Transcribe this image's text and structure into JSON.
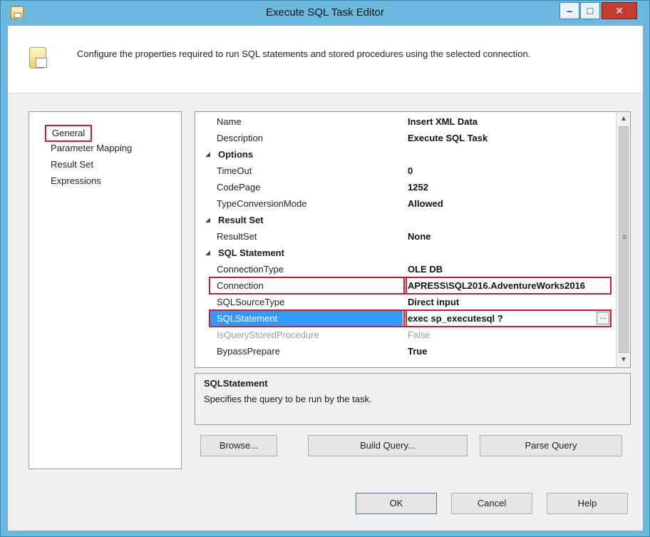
{
  "window": {
    "title": "Execute SQL Task Editor",
    "controls": {
      "minimize": "–",
      "maximize": "□",
      "close": "✕"
    }
  },
  "banner": {
    "icon": "task-editor-icon",
    "text": "Configure the properties required to run SQL statements and stored procedures using the selected connection."
  },
  "nav": {
    "items": [
      {
        "label": "General",
        "selected": true
      },
      {
        "label": "Parameter Mapping"
      },
      {
        "label": "Result Set"
      },
      {
        "label": "Expressions"
      }
    ]
  },
  "grid": {
    "rows": [
      {
        "kind": "prop",
        "name": "Name",
        "value": "Insert XML Data"
      },
      {
        "kind": "prop",
        "name": "Description",
        "value": "Execute SQL Task"
      },
      {
        "kind": "cat",
        "label": "Options",
        "toggle": "◢"
      },
      {
        "kind": "prop",
        "name": "TimeOut",
        "value": "0"
      },
      {
        "kind": "prop",
        "name": "CodePage",
        "value": "1252"
      },
      {
        "kind": "prop",
        "name": "TypeConversionMode",
        "value": "Allowed"
      },
      {
        "kind": "cat",
        "label": "Result Set",
        "toggle": "◢"
      },
      {
        "kind": "prop",
        "name": "ResultSet",
        "value": "None"
      },
      {
        "kind": "cat",
        "label": "SQL Statement",
        "toggle": "◢"
      },
      {
        "kind": "prop",
        "name": "ConnectionType",
        "value": "OLE DB"
      },
      {
        "kind": "prop",
        "name": "Connection",
        "value": "APRESS\\SQL2016.AdventureWorks2016"
      },
      {
        "kind": "prop",
        "name": "SQLSourceType",
        "value": "Direct input"
      },
      {
        "kind": "prop",
        "name": "SQLStatement",
        "value": "exec sp_executesql ?",
        "ellipsis": "..."
      },
      {
        "kind": "prop",
        "name": "IsQueryStoredProcedure",
        "value": "False"
      },
      {
        "kind": "prop",
        "name": "BypassPrepare",
        "value": "True"
      }
    ],
    "scrollbar": {
      "up": "▲",
      "down": "▼",
      "grip": "≡"
    }
  },
  "description": {
    "title": "SQLStatement",
    "text": "Specifies the query to be run by the task."
  },
  "buttons": {
    "browse": "Browse...",
    "build_query": "Build Query...",
    "parse_query": "Parse Query",
    "ok": "OK",
    "cancel": "Cancel",
    "help": "Help"
  },
  "colors": {
    "title_bar": "#6cb9df",
    "highlight_border": "#c4212c",
    "selection": "#3399ff",
    "close_button": "#c43b2f"
  }
}
